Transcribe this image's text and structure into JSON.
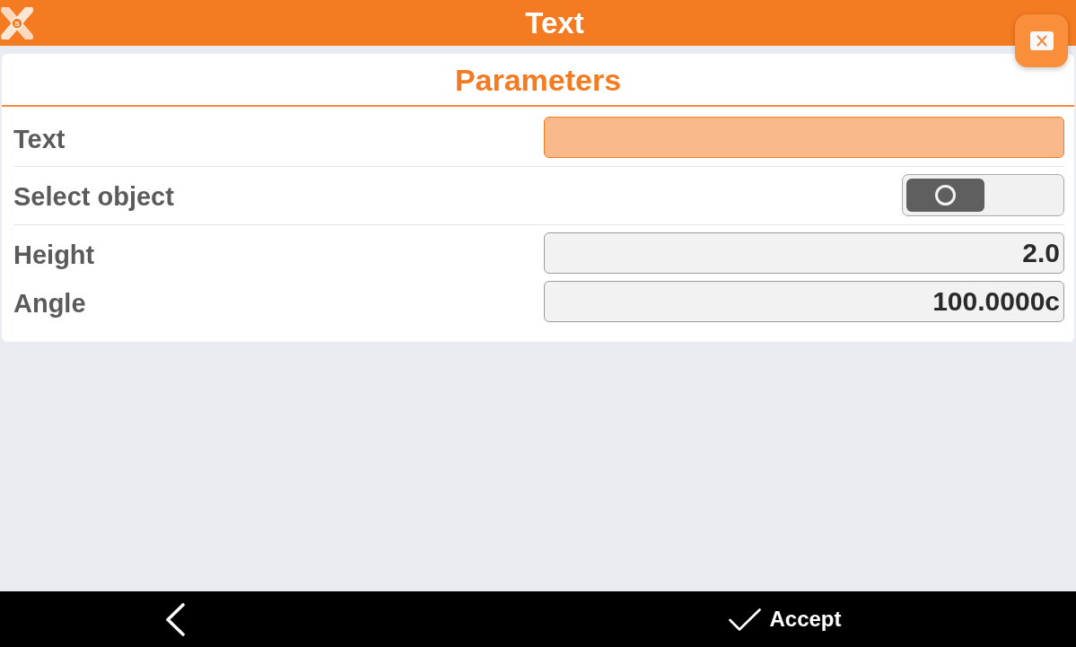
{
  "app_bar": {
    "logo_letter": "S",
    "title": "Text"
  },
  "panel": {
    "title": "Parameters",
    "rows": [
      {
        "kind": "input",
        "label": "Text",
        "focused": true,
        "separated": true
      },
      {
        "kind": "toggle",
        "label": "Select object",
        "on": false,
        "separated": true
      },
      {
        "kind": "input",
        "label": "Height",
        "value": "2.0",
        "focused": false,
        "separated": false
      },
      {
        "kind": "input",
        "label": "Angle",
        "value": "100.0000c",
        "focused": false,
        "separated": false
      }
    ]
  },
  "bottom_bar": {
    "buttons": [
      {
        "kind": "back"
      },
      {
        "kind": "accept",
        "label": "Accept"
      }
    ]
  }
}
